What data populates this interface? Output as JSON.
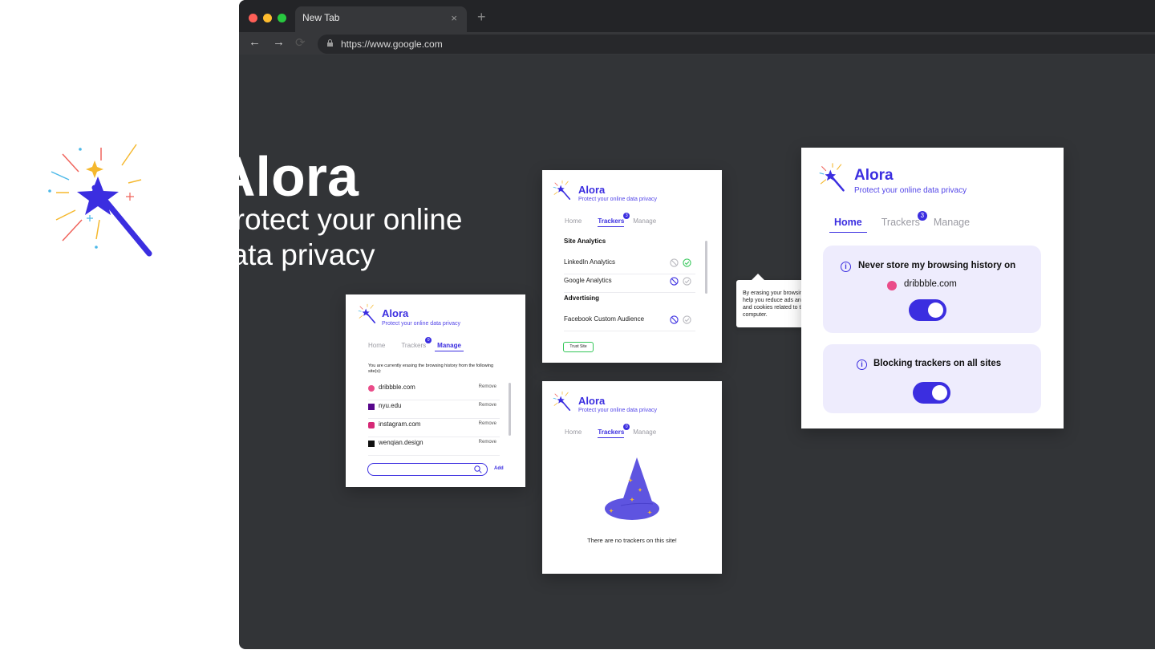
{
  "browser": {
    "tab_title": "New Tab",
    "tab_close": "×",
    "new_tab": "+",
    "url": "https://www.google.com",
    "back": "←",
    "forward": "→",
    "reload": "⟳"
  },
  "hero": {
    "title": "Alora",
    "subtitle": "Protect your online data privacy"
  },
  "brand": {
    "name": "Alora",
    "tagline": "Protect your online data privacy"
  },
  "tabs": {
    "home": "Home",
    "trackers": "Trackers",
    "manage": "Manage"
  },
  "manage_panel": {
    "intro": "You are currently erasing the browsing history from the following site(s):",
    "badge": "0",
    "sites": [
      {
        "name": "dribbble.com",
        "action": "Remove",
        "icon_color": "#ea4c89"
      },
      {
        "name": "nyu.edu",
        "action": "Remove",
        "icon_color": "#57068c"
      },
      {
        "name": "instagram.com",
        "action": "Remove",
        "icon_color": "#d62976"
      },
      {
        "name": "wenqian.design",
        "action": "Remove",
        "icon_color": "#111111"
      }
    ],
    "search_placeholder": "",
    "add_label": "Add"
  },
  "trackers_panel": {
    "badge": "3",
    "sections": [
      {
        "title": "Site Analytics",
        "items": [
          "LinkedIn Analytics",
          "Google Analytics"
        ]
      },
      {
        "title": "Advertising",
        "items": [
          "Facebook Custom Audience"
        ]
      }
    ],
    "trust_button": "Trust Site"
  },
  "empty_panel": {
    "badge": "0",
    "message": "There are no trackers on this site!"
  },
  "tooltip": {
    "text": "By erasing your browsing history, Alora will help you reduce ads and clean the cache and cookies related to this site on your computer."
  },
  "home_panel": {
    "badge": "3",
    "card1_title": "Never store my browsing history on",
    "card1_site": "dribbble.com",
    "card2_title": "Blocking trackers on all sites",
    "info_glyph": "i",
    "toggle1_on": true,
    "toggle2_on": true
  },
  "colors": {
    "accent": "#3b2ee0",
    "browser_bg": "#323437",
    "card_bg": "#eeecfd",
    "check_green": "#34c759"
  }
}
